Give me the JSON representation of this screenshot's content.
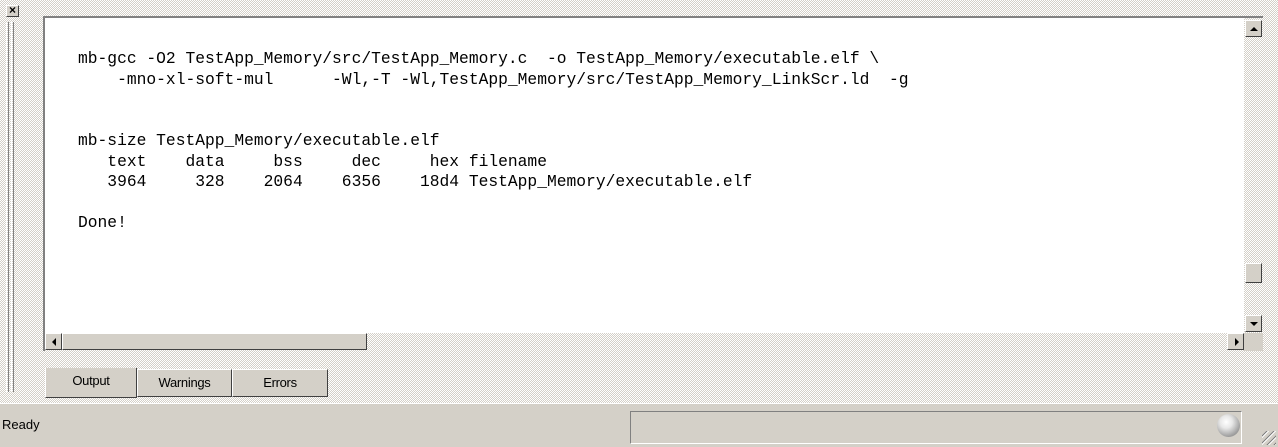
{
  "window": {
    "close_glyph": "×"
  },
  "console": {
    "lines": [
      "mb-gcc -O2 TestApp_Memory/src/TestApp_Memory.c  -o TestApp_Memory/executable.elf \\",
      "    -mno-xl-soft-mul      -Wl,-T -Wl,TestApp_Memory/src/TestApp_Memory_LinkScr.ld  -g",
      "",
      "",
      "mb-size TestApp_Memory/executable.elf",
      "   text    data     bss     dec     hex filename",
      "   3964     328    2064    6356    18d4 TestApp_Memory/executable.elf",
      "",
      "Done!"
    ]
  },
  "tabs": [
    {
      "label": "Output",
      "active": true
    },
    {
      "label": "Warnings",
      "active": false
    },
    {
      "label": "Errors",
      "active": false
    }
  ],
  "status": {
    "text": "Ready"
  },
  "icons": {
    "status_indicator": "status-ball-icon",
    "resize": "resize-grip-icon"
  }
}
